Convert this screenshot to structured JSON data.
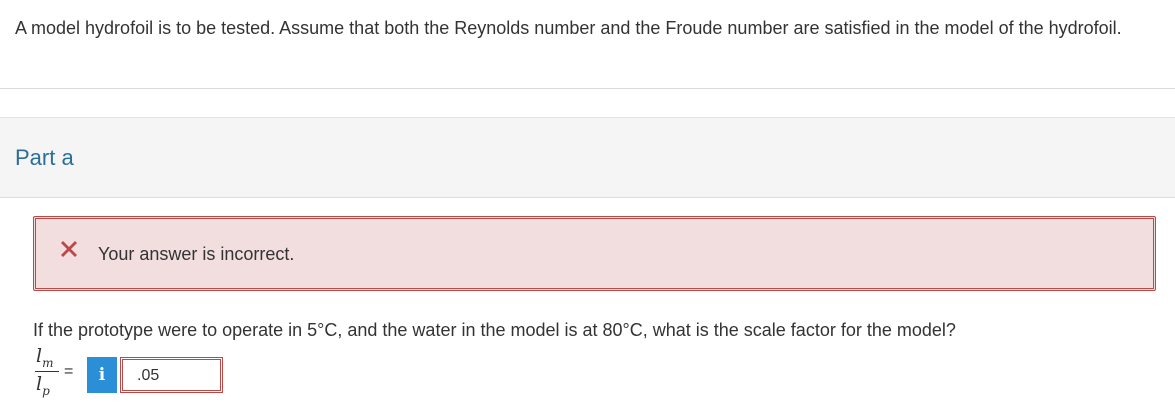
{
  "question": {
    "text": "A model hydrofoil is to be tested. Assume that both the Reynolds number and the Froude number are satisfied in the model of the hydrofoil."
  },
  "part": {
    "title": "Part a"
  },
  "feedback": {
    "icon": "x-mark-icon",
    "message": "Your answer is incorrect.",
    "color": "#b94a48",
    "background": "#f2dede"
  },
  "prompt": {
    "text": "If the prototype were to operate in 5°C, and the water in the model is at 80°C, what is the scale factor for the model?"
  },
  "equation": {
    "numerator_symbol": "l",
    "numerator_sub": "m",
    "denominator_symbol": "l",
    "denominator_sub": "p",
    "equals": "="
  },
  "answer": {
    "info_label": "i",
    "info_color": "#2b8fd8",
    "value": ".05"
  }
}
